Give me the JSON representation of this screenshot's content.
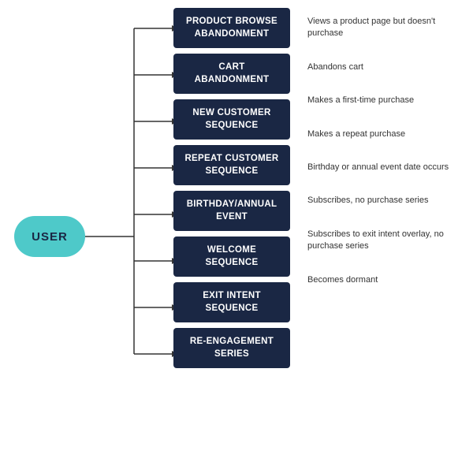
{
  "user": {
    "label": "USER"
  },
  "sequences": [
    {
      "id": "product-browse",
      "box_line1": "PRODUCT BROWSE",
      "box_line2": "ABANDONMENT",
      "label": "Views a product page but doesn't purchase"
    },
    {
      "id": "cart-abandonment",
      "box_line1": "CART",
      "box_line2": "ABANDONMENT",
      "label": "Abandons cart"
    },
    {
      "id": "new-customer",
      "box_line1": "NEW CUSTOMER",
      "box_line2": "SEQUENCE",
      "label": "Makes a first-time purchase"
    },
    {
      "id": "repeat-customer",
      "box_line1": "REPEAT CUSTOMER",
      "box_line2": "SEQUENCE",
      "label": "Makes a repeat purchase"
    },
    {
      "id": "birthday",
      "box_line1": "BIRTHDAY/ANNUAL",
      "box_line2": "EVENT",
      "label": "Birthday or annual event date occurs"
    },
    {
      "id": "welcome",
      "box_line1": "WELCOME",
      "box_line2": "SEQUENCE",
      "label": "Subscribes, no purchase series"
    },
    {
      "id": "exit-intent",
      "box_line1": "EXIT INTENT",
      "box_line2": "SEQUENCE",
      "label": "Subscribes to exit intent overlay, no purchase series"
    },
    {
      "id": "re-engagement",
      "box_line1": "RE-ENGAGEMENT",
      "box_line2": "SERIES",
      "label": "Becomes dormant"
    }
  ],
  "colors": {
    "box_bg": "#1a2744",
    "box_text": "#ffffff",
    "pill_bg": "#4ec9c9",
    "pill_text": "#1a2744",
    "line_color": "#333333",
    "label_text": "#333333",
    "bg": "#ffffff"
  }
}
